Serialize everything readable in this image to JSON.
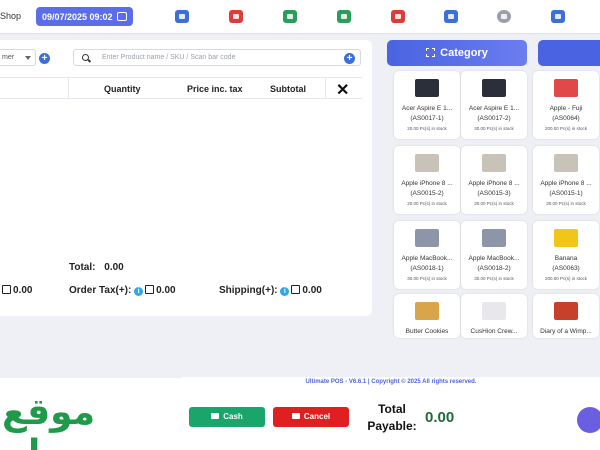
{
  "header": {
    "shop_label": "Shop",
    "datetime": "09/07/2025 09:02",
    "toolbar_icons": [
      {
        "name": "rewind-icon",
        "color": "#3d6fd8"
      },
      {
        "name": "close-square-icon",
        "color": "#e03b3b"
      },
      {
        "name": "briefcase-icon",
        "color": "#2a9d5c"
      },
      {
        "name": "calculator-icon",
        "color": "#2a9d5c"
      },
      {
        "name": "undo-icon",
        "color": "#e03b3b"
      },
      {
        "name": "credit-card-icon",
        "color": "#3d6fd8"
      },
      {
        "name": "settings-icon",
        "color": "#9aa0aa"
      },
      {
        "name": "monitor-icon",
        "color": "#3d6fd8"
      }
    ]
  },
  "cart": {
    "customer_select": "mer",
    "search_placeholder": "Enter Product name / SKU / Scan bar code",
    "columns": {
      "quantity": "Quantity",
      "price": "Price inc. tax",
      "subtotal": "Subtotal"
    },
    "total_label": "Total:",
    "total_value": "0.00",
    "discount_value": "0.00",
    "order_tax_label": "Order Tax(+):",
    "order_tax_value": "0.00",
    "shipping_label": "Shipping(+):",
    "shipping_value": "0.00"
  },
  "products": {
    "category_label": "Category",
    "items": [
      {
        "name": "Acer Aspire E 1...",
        "sku": "(AS0017-1)",
        "stock": "20.00 Pc(s) in stock",
        "color": "#2b2f3a"
      },
      {
        "name": "Acer Aspire E 1...",
        "sku": "(AS0017-2)",
        "stock": "30.00 Pc(s) in stock",
        "color": "#2b2f3a"
      },
      {
        "name": "Apple - Fuji",
        "sku": "(AS0064)",
        "stock": "200.00 Pc(s) in stock",
        "color": "#e0484a"
      },
      {
        "name": "Apple iPhone 8 ...",
        "sku": "(AS0015-2)",
        "stock": "20.00 Pc(s) in stock",
        "color": "#c9c2b8"
      },
      {
        "name": "Apple iPhone 8 ...",
        "sku": "(AS0015-3)",
        "stock": "30.00 Pc(s) in stock",
        "color": "#c9c2b8"
      },
      {
        "name": "Apple iPhone 8 ...",
        "sku": "(AS0015-1)",
        "stock": "30.00 Pc(s) in stock",
        "color": "#c9c2b8"
      },
      {
        "name": "Apple MacBook...",
        "sku": "(AS0018-1)",
        "stock": "30.00 Pc(s) in stock",
        "color": "#8c96a8"
      },
      {
        "name": "Apple MacBook...",
        "sku": "(AS0018-2)",
        "stock": "30.00 Pc(s) in stock",
        "color": "#8c96a8"
      },
      {
        "name": "Banana",
        "sku": "(AS0063)",
        "stock": "200.00 Pc(s) in stock",
        "color": "#f2c519"
      },
      {
        "name": "Butter Cookies",
        "sku": "",
        "stock": "",
        "color": "#d9a54a"
      },
      {
        "name": "CusHion Crew...",
        "sku": "",
        "stock": "",
        "color": "#e8e8ec"
      },
      {
        "name": "Diary of a Wimp...",
        "sku": "",
        "stock": "",
        "color": "#c8402c"
      }
    ]
  },
  "footer": {
    "copyright": "Ultimate POS - V6.6.1 | Copyright © 2025 All rights reserved."
  },
  "bottom": {
    "watermark": "موقع حراج",
    "cash_label": "Cash",
    "cancel_label": "Cancel",
    "total_payable_line1": "Total",
    "total_payable_line2": "Payable:",
    "total_payable_value": "0.00"
  }
}
